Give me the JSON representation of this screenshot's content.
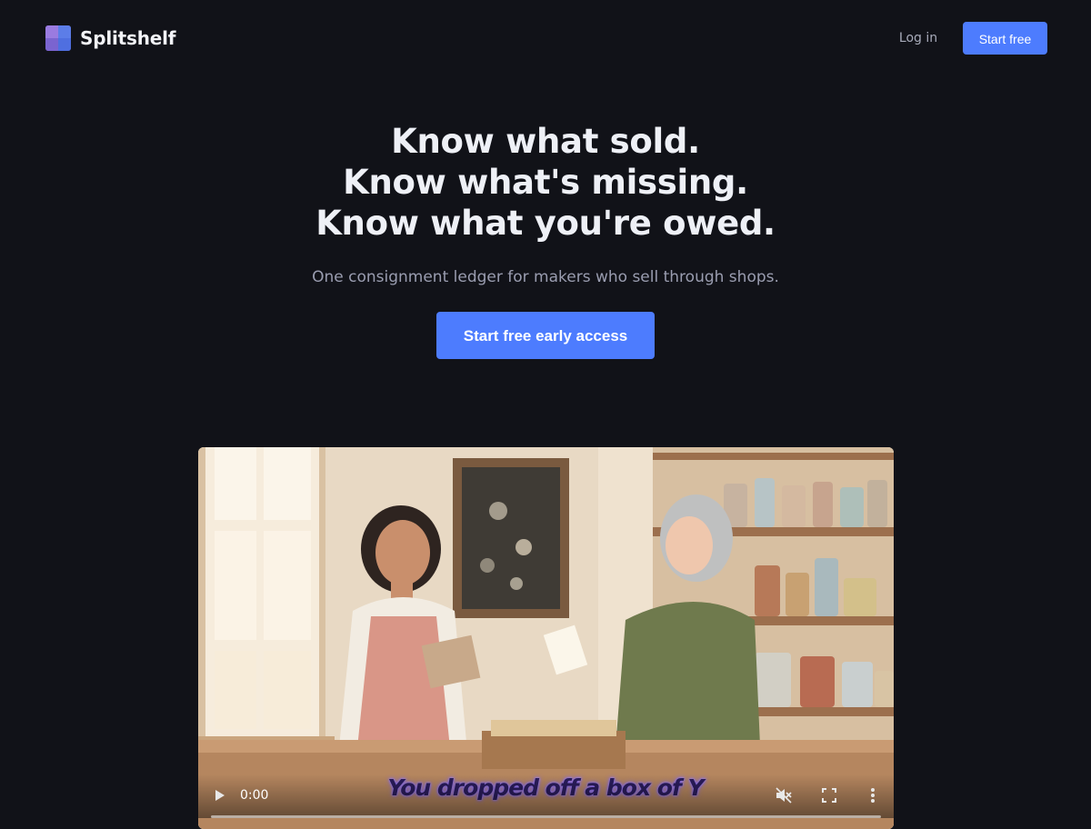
{
  "header": {
    "brand_name": "Splitshelf",
    "login_label": "Log in",
    "start_label": "Start free"
  },
  "hero": {
    "headline": [
      "Know what sold.",
      "Know what's missing.",
      "Know what you're owed."
    ],
    "subtitle": "One consignment ledger for makers who sell through shops.",
    "cta_label": "Start free early access"
  },
  "video": {
    "current_time": "0:00",
    "caption": "You dropped off a box of Y",
    "muted": true,
    "progress": 0
  },
  "colors": {
    "background": "#111218",
    "accent": "#4d7cfe",
    "heading": "#eef0f6",
    "muted_text": "#9a9db0"
  },
  "icons": {
    "logo": "splitshelf-logo-icon",
    "play": "play-icon",
    "mute": "volume-muted-icon",
    "fullscreen": "fullscreen-icon",
    "more": "more-vertical-icon"
  }
}
